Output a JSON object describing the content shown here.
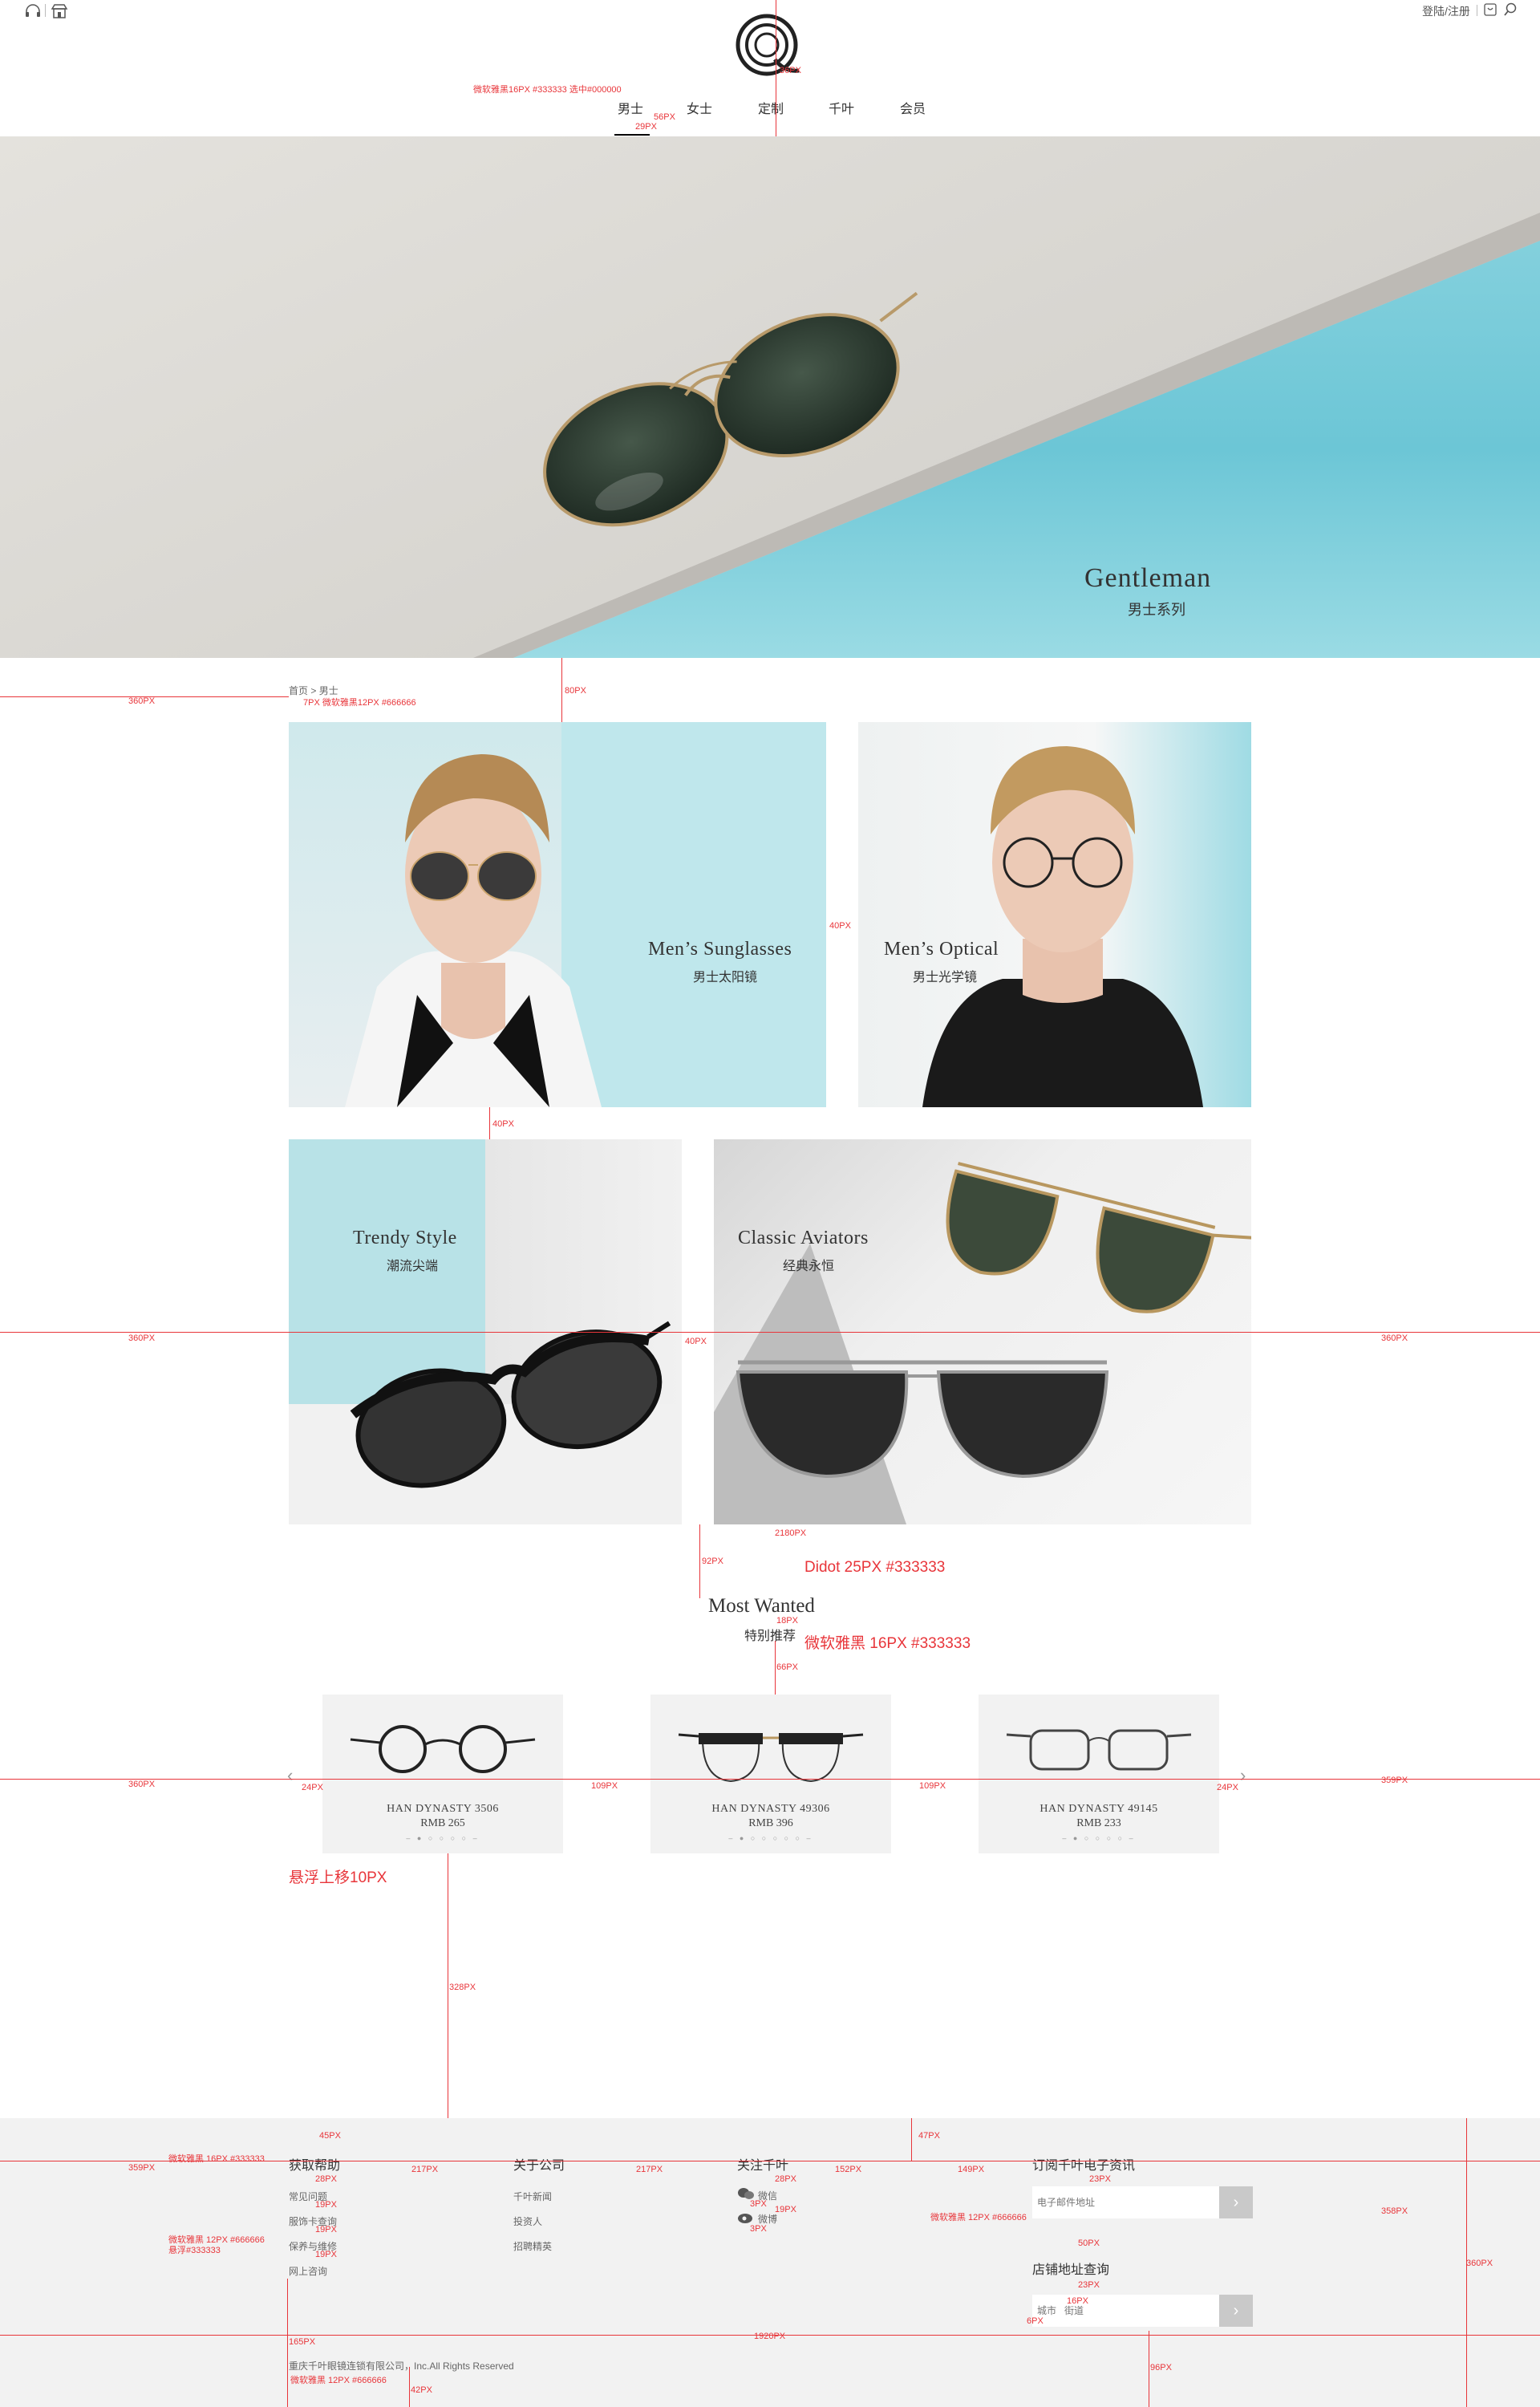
{
  "header": {
    "login_label": "登陆/注册",
    "nav": [
      "男士",
      "女士",
      "定制",
      "千叶",
      "会员"
    ]
  },
  "hero": {
    "title_en": "Gentleman",
    "title_zh": "男士系列"
  },
  "breadcrumb": {
    "home": "首页",
    "sep": ">",
    "current": "男士"
  },
  "tiles": [
    {
      "en": "Men’s Sunglasses",
      "zh": "男士太阳镜"
    },
    {
      "en": "Men’s Optical",
      "zh": "男士光学镜"
    },
    {
      "en": "Trendy Style",
      "zh": "潮流尖端"
    },
    {
      "en": "Classic Aviators",
      "zh": "经典永恒"
    }
  ],
  "most_wanted": {
    "title_en": "Most Wanted",
    "title_zh": "特别推荐"
  },
  "products": [
    {
      "name": "HAN DYNASTY 3506",
      "price": "RMB 265",
      "dots": "– ● ○ ○ ○ ○ –"
    },
    {
      "name": "HAN DYNASTY 49306",
      "price": "RMB 396",
      "dots": "– ● ○ ○ ○ ○ ○ –"
    },
    {
      "name": "HAN DYNASTY 49145",
      "price": "RMB 233",
      "dots": "– ● ○ ○ ○ ○ –"
    }
  ],
  "footer": {
    "help": {
      "title": "获取帮助",
      "links": [
        "常见问题",
        "服饰卡查询",
        "保养与维修",
        "网上咨询"
      ]
    },
    "about": {
      "title": "关于公司",
      "links": [
        "千叶新闻",
        "投资人",
        "招聘精英"
      ]
    },
    "follow": {
      "title": "关注千叶",
      "links": [
        "微信",
        "微博"
      ]
    },
    "subscribe": {
      "title": "订阅千叶电子资讯",
      "placeholder": "电子邮件地址"
    },
    "store": {
      "title": "店铺地址查询",
      "placeholder": "城市   街道"
    },
    "copyright": "重庆千叶眼镜连锁有限公司，Inc.All Rights Reserved"
  },
  "annotations": {
    "nav_font": "微软雅黑16PX #333333 选中#000000",
    "a_36px": "36PX",
    "a_56px": "56PX",
    "a_29px": "29PX",
    "a_360px": "360PX",
    "a_80px": "80PX",
    "a_breadcrumb": "7PX 微软雅黑12PX #666666",
    "a_40px": "40PX",
    "a_2180px": "2180PX",
    "a_92px": "92PX",
    "a_didot": "Didot   25PX #333333",
    "a_18px": "18PX",
    "a_yahei16": "微软雅黑   16PX #333333",
    "a_66px": "66PX",
    "a_24px": "24PX",
    "a_109px": "109PX",
    "a_359px": "359PX",
    "a_hover": "悬浮上移10PX",
    "a_328px": "328PX",
    "a_45px": "45PX",
    "a_f16": "微软雅黑   16PX #333333",
    "a_28px": "28PX",
    "a_19px": "19PX",
    "a_f12": "微软雅黑   12PX #666666",
    "a_f12b": "悬浮#333333",
    "a_217px": "217PX",
    "a_3px": "3PX",
    "a_152px": "152PX",
    "a_47px": "47PX",
    "a_149px": "149PX",
    "a_23px": "23PX",
    "a_358px": "358PX",
    "a_f12c": "微软雅黑   12PX #666666",
    "a_50px": "50PX",
    "a_16px": "16PX",
    "a_6px": "6PX",
    "a_165px": "165PX",
    "a_1920px": "1920PX",
    "a_f12d": "微软雅黑   12PX #666666",
    "a_42px": "42PX",
    "a_96px": "96PX"
  }
}
